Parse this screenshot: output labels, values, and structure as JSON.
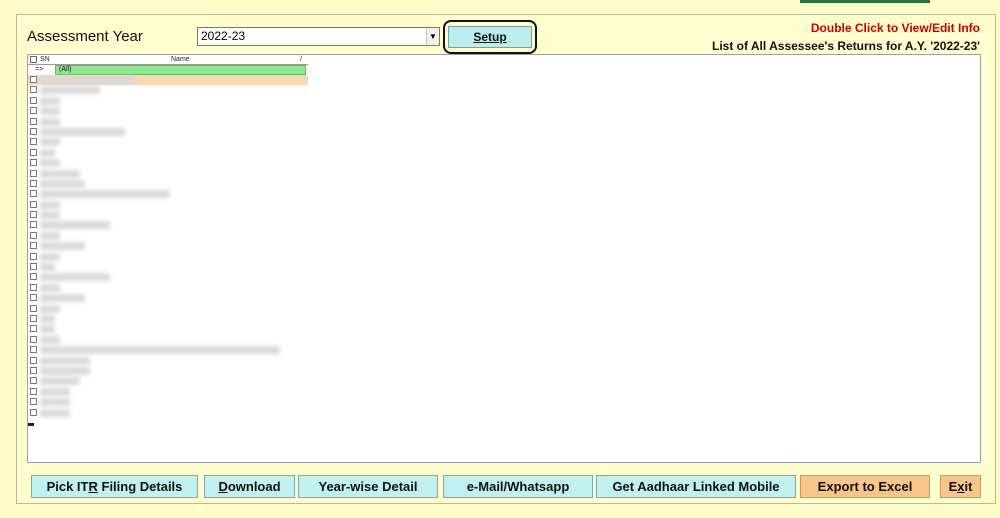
{
  "header": {
    "assessment_year_label": "Assessment Year",
    "assessment_year_value": "2022-23",
    "setup_label": "Setup",
    "hint_red": "Double Click to View/Edit Info",
    "hint_list": "List of All Assessee's Returns for A.Y. '2022-23'"
  },
  "grid": {
    "columns": [
      "SN",
      "Name"
    ],
    "sort_indicator": "/",
    "filter_marker": "=>",
    "filter_value": "(All)",
    "rows_visible_count": 33
  },
  "buttons": [
    {
      "key": "pick_itr",
      "pre": "Pick IT",
      "u": "R",
      "post": " Filing Details"
    },
    {
      "key": "download",
      "pre": "",
      "u": "D",
      "post": "ownload"
    },
    {
      "key": "year_wise",
      "pre": "",
      "u": "",
      "post": "Year-wise Detail"
    },
    {
      "key": "email_whatsapp",
      "pre": "",
      "u": "",
      "post": "e-Mail/Whatsapp"
    },
    {
      "key": "aadhaar_mobile",
      "pre": "",
      "u": "",
      "post": "Get Aadhaar Linked Mobile"
    },
    {
      "key": "export_excel",
      "pre": "",
      "u": "",
      "post": "Export to Excel"
    },
    {
      "key": "exit",
      "pre": "E",
      "u": "x",
      "post": "it"
    }
  ],
  "colors": {
    "background": "#fdfcc9",
    "button": "#c0f0f0",
    "export_button": "#fac588",
    "filter_row": "#8ee88e",
    "hint_red": "#c80000"
  }
}
